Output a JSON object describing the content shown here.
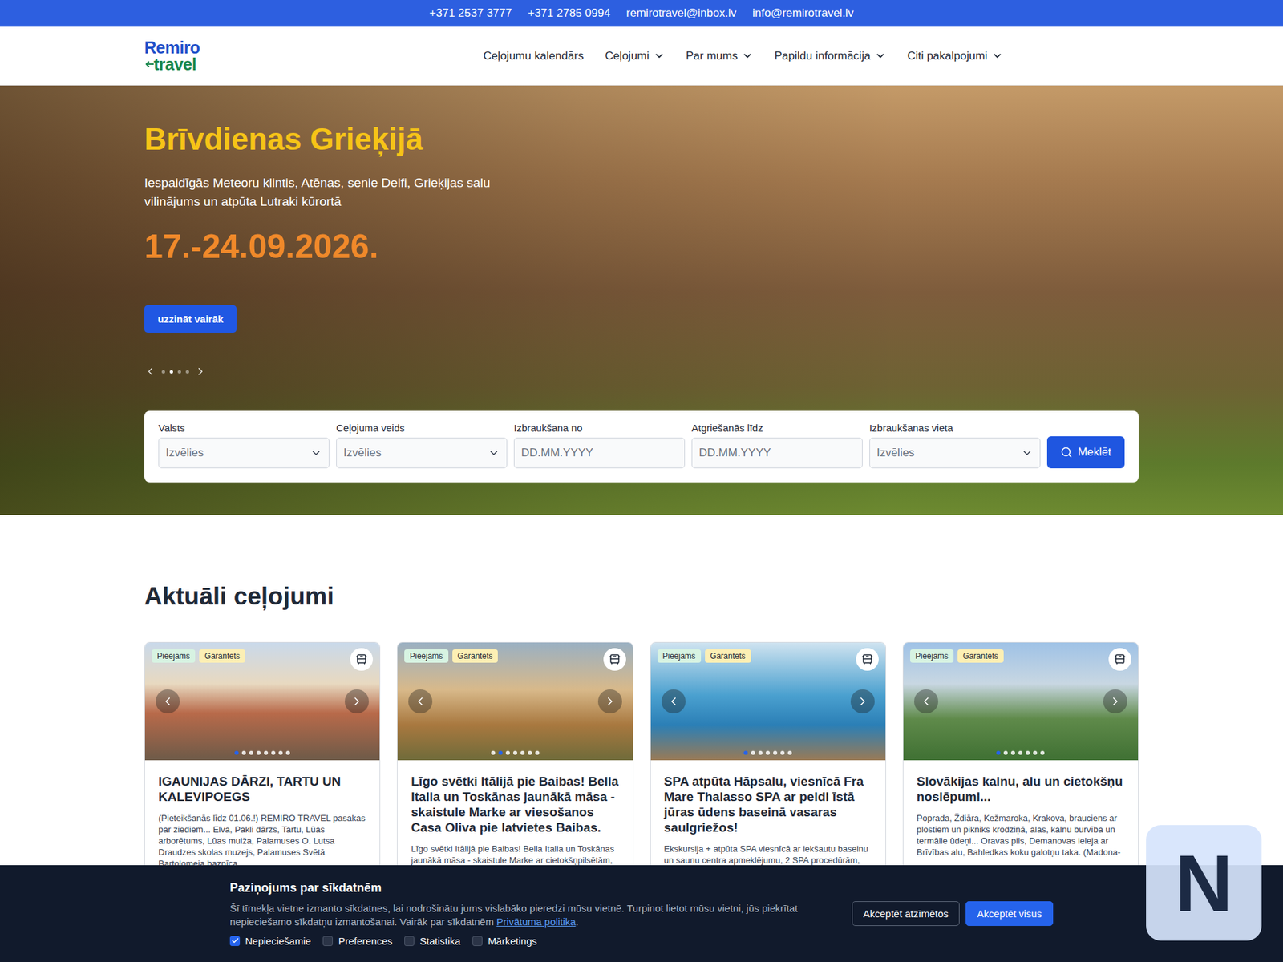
{
  "topbar": {
    "contacts": [
      "+371 2537 3777",
      "+371 2785 0994",
      "remirotravel@inbox.lv",
      "info@remirotravel.lv"
    ]
  },
  "logo": {
    "top": "Remiro",
    "bottom": "travel"
  },
  "nav": [
    {
      "label": "Ceļojumu kalendārs",
      "dropdown": false
    },
    {
      "label": "Ceļojumi",
      "dropdown": true
    },
    {
      "label": "Par mums",
      "dropdown": true
    },
    {
      "label": "Papildu informācija",
      "dropdown": true
    },
    {
      "label": "Citi pakalpojumi",
      "dropdown": true
    }
  ],
  "hero": {
    "title": "Brīvdienas Grieķijā",
    "subtitle": "Iespaidīgās Meteoru klintis, Atēnas, senie Delfi, Grieķijas salu vilinājums un atpūta Lutraki kūrortā",
    "date": "17.-24.09.2026.",
    "button": "uzzināt vairāk",
    "slides": [
      {
        "selected": false
      },
      {
        "selected": true
      },
      {
        "selected": false
      },
      {
        "selected": false
      }
    ]
  },
  "search": {
    "fields": [
      {
        "label": "Valsts",
        "placeholder": "Izvēlies",
        "kind": "select"
      },
      {
        "label": "Ceļojuma veids",
        "placeholder": "Izvēlies",
        "kind": "select"
      },
      {
        "label": "Izbraukšana no",
        "placeholder": "DD.MM.YYYY",
        "kind": "date"
      },
      {
        "label": "Atgriešanās līdz",
        "placeholder": "DD.MM.YYYY",
        "kind": "date"
      },
      {
        "label": "Izbraukšanas vieta",
        "placeholder": "Izvēlies",
        "kind": "select"
      }
    ],
    "button": "Meklēt"
  },
  "section": {
    "title": "Aktuāli ceļojumi"
  },
  "cards": [
    {
      "badges": [
        {
          "label": "Pieejams",
          "color": "#d7f3e2"
        },
        {
          "label": "Garantēts",
          "color": "#fcefb4"
        }
      ],
      "slides": [
        {
          "selected": true
        },
        {
          "selected": false
        },
        {
          "selected": false
        },
        {
          "selected": false
        },
        {
          "selected": false
        },
        {
          "selected": false
        },
        {
          "selected": false
        },
        {
          "selected": false
        }
      ],
      "title": "IGAUNIJAS DĀRZI, TARTU UN KALEVIPOEGS",
      "text": "(Pieteikšanās līdz 01.06.!) REMIRO TRAVEL pasakas par ziediem... Elva, Pakli dārzs, Tartu, Lūas arborētums, Lūas muiža, Palamuses O. Lutsa Draudzes skolas muzejs, Palamuses Svētā Bartolomeja baznīca"
    },
    {
      "badges": [
        {
          "label": "Pieejams",
          "color": "#d7f3e2"
        },
        {
          "label": "Garantēts",
          "color": "#fcefb4"
        }
      ],
      "slides": [
        {
          "selected": false
        },
        {
          "selected": true
        },
        {
          "selected": false
        },
        {
          "selected": false
        },
        {
          "selected": false
        },
        {
          "selected": false
        },
        {
          "selected": false
        }
      ],
      "title": "Līgo svētki Itālijā pie Baibas! Bella Italia un Toskānas jaunākā māsa - skaistule Marke ar viesošanos Casa Oliva pie latvietes Baibas.",
      "text": "Līgo svētki Itālijā pie Baibas! Bella Italia un Toskānas jaunākā māsa - skaistule Marke ar cietokšņpilsētām,"
    },
    {
      "badges": [
        {
          "label": "Pieejams",
          "color": "#d7f3e2"
        },
        {
          "label": "Garantēts",
          "color": "#fcefb4"
        }
      ],
      "slides": [
        {
          "selected": true
        },
        {
          "selected": false
        },
        {
          "selected": false
        },
        {
          "selected": false
        },
        {
          "selected": false
        },
        {
          "selected": false
        },
        {
          "selected": false
        }
      ],
      "title": "SPA atpūta Hāpsalu, viesnīcā Fra Mare Thalasso SPA ar peldi īstā jūras ūdens baseinā vasaras saulgriežos!",
      "text": "Ekskursija + atpūta SPA viesnīcā ar iekšautu baseinu un saunu centra apmeklējumu, 2 SPA procedūrām,"
    },
    {
      "badges": [
        {
          "label": "Pieejams",
          "color": "#d7f3e2"
        },
        {
          "label": "Garantēts",
          "color": "#fcefb4"
        }
      ],
      "slides": [
        {
          "selected": true
        },
        {
          "selected": false
        },
        {
          "selected": false
        },
        {
          "selected": false
        },
        {
          "selected": false
        },
        {
          "selected": false
        },
        {
          "selected": false
        }
      ],
      "title": "Slovākijas kalnu, alu un cietokšņu noslēpumi...",
      "text": "Poprada, Ždiāra, Kežmaroka, Krakova, brauciens ar plostiem un pikniks krodziņā, alas, kalnu burvība un termālie ūdeņi... Oravas pils, Demanovas ieleja ar Brīvības alu, Bahledkas koku galotņu taka. (Madona-"
    }
  ],
  "cookies": {
    "title": "Paziņojums par sīkdatnēm",
    "text": "Šī tīmekļa vietne izmanto sīkdatnes, lai nodrošinātu jums vislabāko pieredzi mūsu vietnē. Turpinot lietot mūsu vietni, jūs piekrītat nepieciešamo sīkdatņu izmantošanai. Vairāk par sīkdatnēm ",
    "link": "Privātuma politika",
    "after": ".",
    "options": [
      {
        "label": "Nepieciešamie",
        "checked": true
      },
      {
        "label": "Preferences",
        "checked": false
      },
      {
        "label": "Statistika",
        "checked": false
      },
      {
        "label": "Mārketings",
        "checked": false
      }
    ],
    "buttons": [
      {
        "label": "Akceptēt atzīmētos",
        "kind": "outline"
      },
      {
        "label": "Akceptēt visus",
        "kind": "primary"
      }
    ]
  },
  "widget": {
    "label": "N"
  }
}
